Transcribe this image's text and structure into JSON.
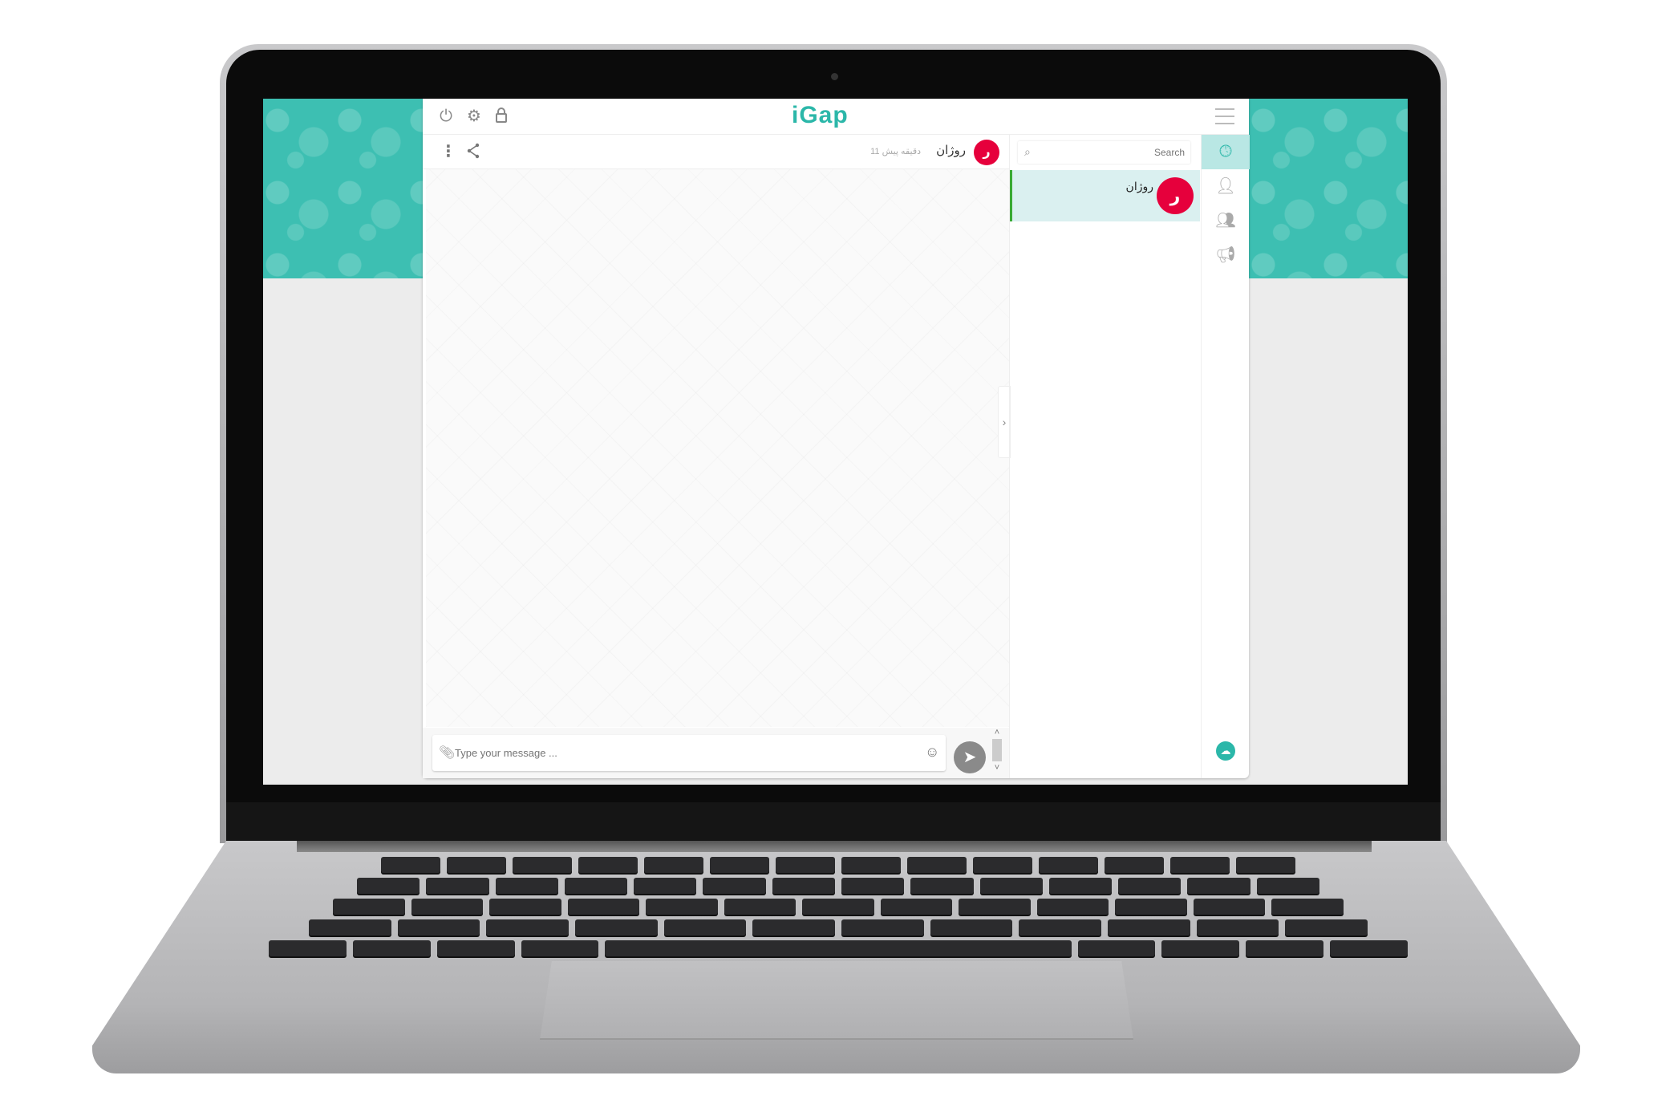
{
  "header": {
    "logo": "iGap",
    "icons": [
      "power-icon",
      "gear-icon",
      "lock-icon"
    ],
    "menu_icon": "hamburger-icon"
  },
  "chat": {
    "contact_name": "روژان",
    "avatar_letter": "ر",
    "last_seen": "11 دقیقه پیش",
    "icons": [
      "more-vertical-icon",
      "share-icon"
    ]
  },
  "composer": {
    "placeholder": "Type your message ...",
    "icons": [
      "paperclip-icon",
      "emoji-icon",
      "send-icon"
    ]
  },
  "contacts": {
    "search_placeholder": "Search",
    "items": [
      {
        "name": "روژان",
        "avatar_letter": "ر",
        "selected": true
      }
    ]
  },
  "nav": {
    "items": [
      "recent-chats",
      "contacts",
      "groups",
      "channels"
    ],
    "bottom": "cloud-icon"
  },
  "colors": {
    "accent": "#2bb7a9",
    "avatar": "#e6003c",
    "selected_row": "#daf0f0",
    "selected_border": "#3aaa35"
  }
}
